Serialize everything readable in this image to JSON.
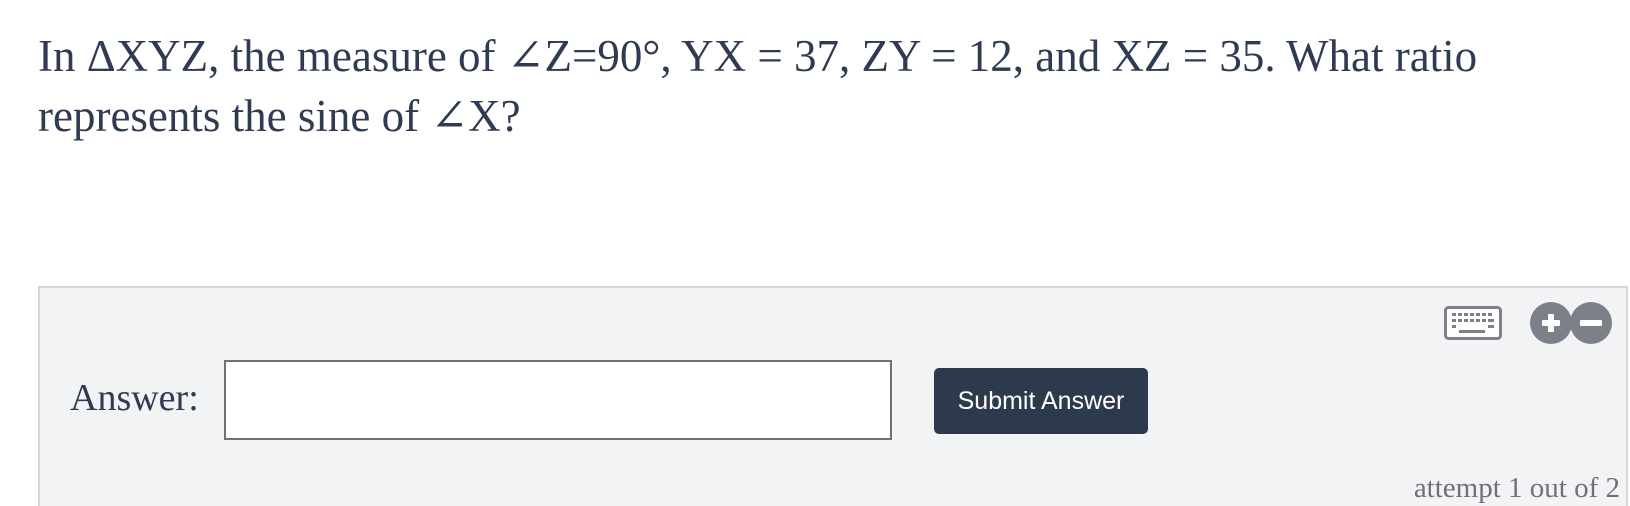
{
  "question": {
    "line1": "In ΔXYZ, the measure of ∠Z=90°, YX = 37, ZY = 12, and XZ = 35. What ratio",
    "line2": "represents the sine of ∠X?"
  },
  "answer_panel": {
    "label": "Answer:",
    "input_value": "",
    "submit_label": "Submit Answer",
    "attempt_text": "attempt 1 out of 2",
    "icons": {
      "keyboard": "keyboard-icon",
      "zoom_in": "plus-icon",
      "zoom_out": "minus-icon"
    },
    "colors": {
      "panel_bg": "#f2f3f5",
      "button_bg": "#2d3a4d",
      "icon_gray": "#7d8088"
    }
  }
}
